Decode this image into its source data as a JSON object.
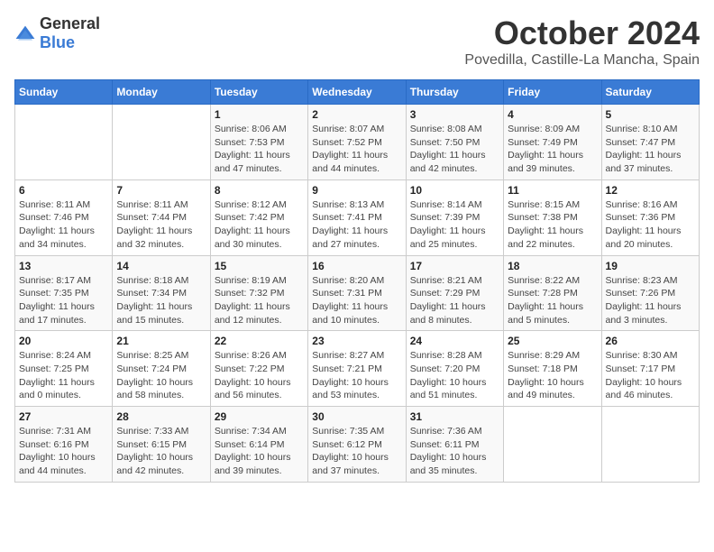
{
  "logo": {
    "general": "General",
    "blue": "Blue"
  },
  "header": {
    "month": "October 2024",
    "location": "Povedilla, Castille-La Mancha, Spain"
  },
  "weekdays": [
    "Sunday",
    "Monday",
    "Tuesday",
    "Wednesday",
    "Thursday",
    "Friday",
    "Saturday"
  ],
  "weeks": [
    [
      {
        "day": "",
        "info": ""
      },
      {
        "day": "",
        "info": ""
      },
      {
        "day": "1",
        "info": "Sunrise: 8:06 AM\nSunset: 7:53 PM\nDaylight: 11 hours and 47 minutes."
      },
      {
        "day": "2",
        "info": "Sunrise: 8:07 AM\nSunset: 7:52 PM\nDaylight: 11 hours and 44 minutes."
      },
      {
        "day": "3",
        "info": "Sunrise: 8:08 AM\nSunset: 7:50 PM\nDaylight: 11 hours and 42 minutes."
      },
      {
        "day": "4",
        "info": "Sunrise: 8:09 AM\nSunset: 7:49 PM\nDaylight: 11 hours and 39 minutes."
      },
      {
        "day": "5",
        "info": "Sunrise: 8:10 AM\nSunset: 7:47 PM\nDaylight: 11 hours and 37 minutes."
      }
    ],
    [
      {
        "day": "6",
        "info": "Sunrise: 8:11 AM\nSunset: 7:46 PM\nDaylight: 11 hours and 34 minutes."
      },
      {
        "day": "7",
        "info": "Sunrise: 8:11 AM\nSunset: 7:44 PM\nDaylight: 11 hours and 32 minutes."
      },
      {
        "day": "8",
        "info": "Sunrise: 8:12 AM\nSunset: 7:42 PM\nDaylight: 11 hours and 30 minutes."
      },
      {
        "day": "9",
        "info": "Sunrise: 8:13 AM\nSunset: 7:41 PM\nDaylight: 11 hours and 27 minutes."
      },
      {
        "day": "10",
        "info": "Sunrise: 8:14 AM\nSunset: 7:39 PM\nDaylight: 11 hours and 25 minutes."
      },
      {
        "day": "11",
        "info": "Sunrise: 8:15 AM\nSunset: 7:38 PM\nDaylight: 11 hours and 22 minutes."
      },
      {
        "day": "12",
        "info": "Sunrise: 8:16 AM\nSunset: 7:36 PM\nDaylight: 11 hours and 20 minutes."
      }
    ],
    [
      {
        "day": "13",
        "info": "Sunrise: 8:17 AM\nSunset: 7:35 PM\nDaylight: 11 hours and 17 minutes."
      },
      {
        "day": "14",
        "info": "Sunrise: 8:18 AM\nSunset: 7:34 PM\nDaylight: 11 hours and 15 minutes."
      },
      {
        "day": "15",
        "info": "Sunrise: 8:19 AM\nSunset: 7:32 PM\nDaylight: 11 hours and 12 minutes."
      },
      {
        "day": "16",
        "info": "Sunrise: 8:20 AM\nSunset: 7:31 PM\nDaylight: 11 hours and 10 minutes."
      },
      {
        "day": "17",
        "info": "Sunrise: 8:21 AM\nSunset: 7:29 PM\nDaylight: 11 hours and 8 minutes."
      },
      {
        "day": "18",
        "info": "Sunrise: 8:22 AM\nSunset: 7:28 PM\nDaylight: 11 hours and 5 minutes."
      },
      {
        "day": "19",
        "info": "Sunrise: 8:23 AM\nSunset: 7:26 PM\nDaylight: 11 hours and 3 minutes."
      }
    ],
    [
      {
        "day": "20",
        "info": "Sunrise: 8:24 AM\nSunset: 7:25 PM\nDaylight: 11 hours and 0 minutes."
      },
      {
        "day": "21",
        "info": "Sunrise: 8:25 AM\nSunset: 7:24 PM\nDaylight: 10 hours and 58 minutes."
      },
      {
        "day": "22",
        "info": "Sunrise: 8:26 AM\nSunset: 7:22 PM\nDaylight: 10 hours and 56 minutes."
      },
      {
        "day": "23",
        "info": "Sunrise: 8:27 AM\nSunset: 7:21 PM\nDaylight: 10 hours and 53 minutes."
      },
      {
        "day": "24",
        "info": "Sunrise: 8:28 AM\nSunset: 7:20 PM\nDaylight: 10 hours and 51 minutes."
      },
      {
        "day": "25",
        "info": "Sunrise: 8:29 AM\nSunset: 7:18 PM\nDaylight: 10 hours and 49 minutes."
      },
      {
        "day": "26",
        "info": "Sunrise: 8:30 AM\nSunset: 7:17 PM\nDaylight: 10 hours and 46 minutes."
      }
    ],
    [
      {
        "day": "27",
        "info": "Sunrise: 7:31 AM\nSunset: 6:16 PM\nDaylight: 10 hours and 44 minutes."
      },
      {
        "day": "28",
        "info": "Sunrise: 7:33 AM\nSunset: 6:15 PM\nDaylight: 10 hours and 42 minutes."
      },
      {
        "day": "29",
        "info": "Sunrise: 7:34 AM\nSunset: 6:14 PM\nDaylight: 10 hours and 39 minutes."
      },
      {
        "day": "30",
        "info": "Sunrise: 7:35 AM\nSunset: 6:12 PM\nDaylight: 10 hours and 37 minutes."
      },
      {
        "day": "31",
        "info": "Sunrise: 7:36 AM\nSunset: 6:11 PM\nDaylight: 10 hours and 35 minutes."
      },
      {
        "day": "",
        "info": ""
      },
      {
        "day": "",
        "info": ""
      }
    ]
  ]
}
